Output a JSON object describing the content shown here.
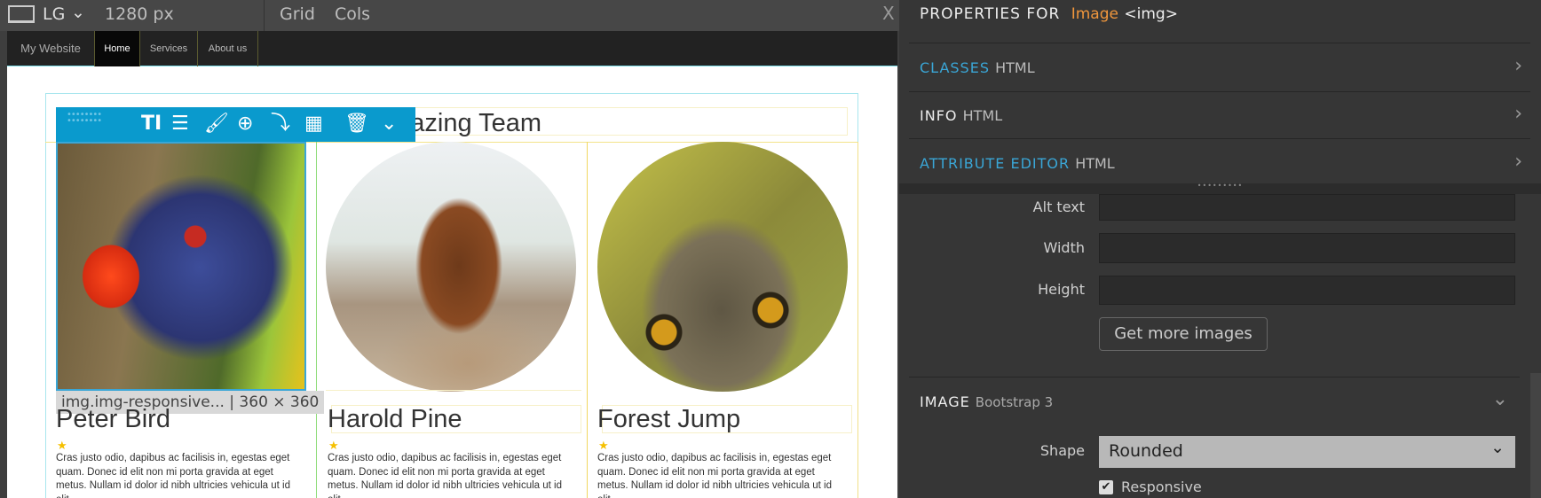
{
  "topbar": {
    "device_icon": "laptop-icon",
    "breakpoint": "LG",
    "width": "1280 px",
    "grid": "Grid",
    "cols": "Cols",
    "close": "X"
  },
  "site": {
    "nav": {
      "brand": "My Website",
      "items": [
        "Home",
        "Services",
        "About us"
      ],
      "active": "Home"
    },
    "section_title": "Our Amazing Team",
    "toolbar": {
      "icons": [
        "drag-handle-icon",
        "text-cursor-icon",
        "sliders-icon",
        "brush-icon",
        "add-circle-icon",
        "insert-icon",
        "grid-icon",
        "trash-icon",
        "chevron-down-icon"
      ]
    },
    "selection_label": "img.img-responsive... | 360 × 360",
    "members": [
      {
        "name": "Peter Bird",
        "image": "parrot",
        "text": "Cras justo odio, dapibus ac facilisis in, egestas eget quam. Donec id elit non mi porta gravida at eget metus. Nullam id dolor id nibh ultricies vehicula ut id elit."
      },
      {
        "name": "Harold Pine",
        "image": "horse",
        "text": "Cras justo odio, dapibus ac facilisis in, egestas eget quam. Donec id elit non mi porta gravida at eget metus. Nullam id dolor id nibh ultricies vehicula ut id elit."
      },
      {
        "name": "Forest Jump",
        "image": "owl",
        "text": "Cras justo odio, dapibus ac facilisis in, egestas eget quam. Donec id elit non mi porta gravida at eget metus. Nullam id dolor id nibh ultricies vehicula ut id elit."
      }
    ]
  },
  "panel": {
    "header_prefix": "PROPERTIES FOR",
    "header_element": "Image",
    "header_tag": "<img>",
    "sections": [
      {
        "title": "CLASSES",
        "sub": "HTML"
      },
      {
        "title": "INFO",
        "sub": "HTML"
      },
      {
        "title": "ATTRIBUTE EDITOR",
        "sub": "HTML"
      }
    ],
    "fields": {
      "alt_label": "Alt text",
      "alt_value": "",
      "width_label": "Width",
      "width_value": "",
      "height_label": "Height",
      "height_value": "",
      "more_images": "Get more images"
    },
    "image_section": {
      "title": "IMAGE",
      "sub": "Bootstrap 3",
      "shape_label": "Shape",
      "shape_value": "Rounded",
      "responsive_label": "Responsive",
      "responsive_checked": true
    },
    "colors": {
      "accent_blue": "#3aa6d6",
      "accent_orange": "#f0963c",
      "toolbar": "#0a9acd"
    }
  }
}
